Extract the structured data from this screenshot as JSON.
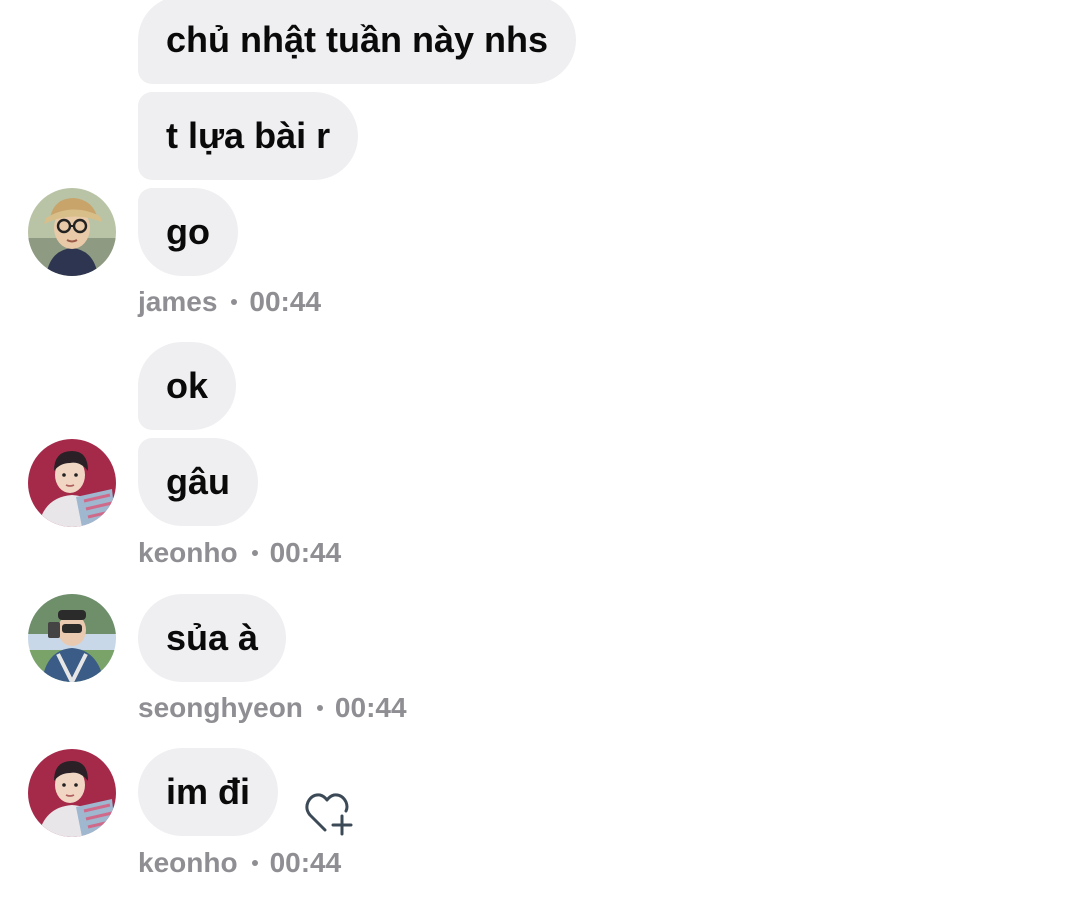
{
  "messages": [
    {
      "text": "chủ nhật tuần này nhs"
    },
    {
      "text": "t lựa bài r"
    },
    {
      "text": "go"
    },
    {
      "text": "ok"
    },
    {
      "text": "gâu"
    },
    {
      "text": "sủa à"
    },
    {
      "text": "im đi"
    }
  ],
  "groups": [
    {
      "sender": "james",
      "time": "00:44",
      "avatar": "avatar-james"
    },
    {
      "sender": "keonho",
      "time": "00:44",
      "avatar": "avatar-keonho"
    },
    {
      "sender": "seonghyeon",
      "time": "00:44",
      "avatar": "avatar-seonghyeon"
    },
    {
      "sender": "keonho",
      "time": "00:44",
      "avatar": "avatar-keonho"
    }
  ],
  "icons": {
    "react": "heart-plus-icon"
  },
  "colors": {
    "bubble": "#efeff1",
    "meta_text": "#8e8e93",
    "message_text": "#0a0a0a",
    "icon_stroke": "#3c4a57"
  }
}
